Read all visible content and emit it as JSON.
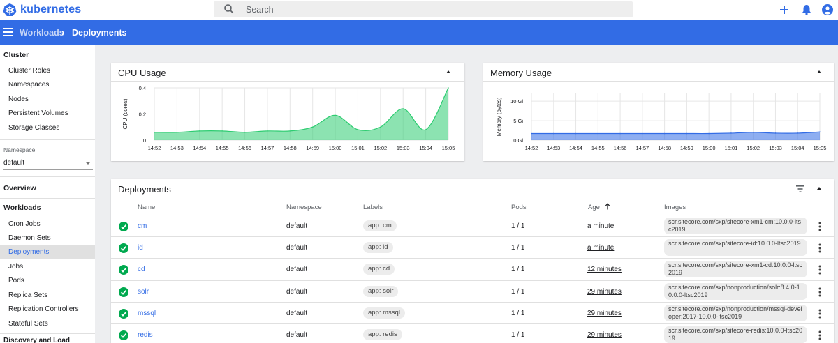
{
  "app": {
    "brand": "kubernetes"
  },
  "search": {
    "placeholder": "Search"
  },
  "breadcrumb": {
    "parent": "Workloads",
    "current": "Deployments"
  },
  "sidebar": {
    "cluster_heading": "Cluster",
    "cluster_items": [
      "Cluster Roles",
      "Namespaces",
      "Nodes",
      "Persistent Volumes",
      "Storage Classes"
    ],
    "namespace_label": "Namespace",
    "namespace_value": "default",
    "overview": "Overview",
    "workloads_heading": "Workloads",
    "workload_items": [
      "Cron Jobs",
      "Daemon Sets",
      "Deployments",
      "Jobs",
      "Pods",
      "Replica Sets",
      "Replication Controllers",
      "Stateful Sets"
    ],
    "active_item": "Deployments",
    "discovery_heading": "Discovery and Load Balancing"
  },
  "cpu": {
    "title": "CPU Usage",
    "chart_data": {
      "type": "area",
      "ylabel": "CPU (cores)",
      "x": [
        "14:52",
        "14:53",
        "14:54",
        "14:55",
        "14:56",
        "14:57",
        "14:58",
        "14:59",
        "15:00",
        "15:01",
        "15:02",
        "15:03",
        "15:04",
        "15:05"
      ],
      "yticks": [
        "0",
        "0.2",
        "0.4"
      ],
      "ylim": [
        0,
        0.4
      ],
      "values": [
        0.06,
        0.06,
        0.07,
        0.07,
        0.06,
        0.07,
        0.07,
        0.1,
        0.19,
        0.08,
        0.1,
        0.24,
        0.08,
        0.4
      ],
      "color": "#2ecc71"
    }
  },
  "memory": {
    "title": "Memory Usage",
    "chart_data": {
      "type": "area",
      "ylabel": "Memory (bytes)",
      "x": [
        "14:52",
        "14:53",
        "14:54",
        "14:55",
        "14:56",
        "14:57",
        "14:58",
        "14:59",
        "15:00",
        "15:01",
        "15:02",
        "15:03",
        "15:04",
        "15:05"
      ],
      "yticks": [
        "0 Gi",
        "5 Gi",
        "10 Gi"
      ],
      "ylim": [
        0,
        12
      ],
      "values": [
        1.7,
        1.7,
        1.7,
        1.7,
        1.7,
        1.7,
        1.7,
        1.7,
        1.7,
        1.8,
        2.0,
        1.8,
        1.8,
        2.1
      ],
      "color": "#326ce5"
    }
  },
  "deployments": {
    "title": "Deployments",
    "columns": {
      "name": "Name",
      "namespace": "Namespace",
      "labels": "Labels",
      "pods": "Pods",
      "age": "Age",
      "images": "Images"
    },
    "rows": [
      {
        "name": "cm",
        "namespace": "default",
        "label": "app: cm",
        "pods": "1 / 1",
        "age": "a minute",
        "image": "scr.sitecore.com/sxp/sitecore-xm1-cm:10.0.0-ltsc2019"
      },
      {
        "name": "id",
        "namespace": "default",
        "label": "app: id",
        "pods": "1 / 1",
        "age": "a minute",
        "image": "scr.sitecore.com/sxp/sitecore-id:10.0.0-ltsc2019"
      },
      {
        "name": "cd",
        "namespace": "default",
        "label": "app: cd",
        "pods": "1 / 1",
        "age": "12 minutes",
        "image": "scr.sitecore.com/sxp/sitecore-xm1-cd:10.0.0-ltsc2019"
      },
      {
        "name": "solr",
        "namespace": "default",
        "label": "app: solr",
        "pods": "1 / 1",
        "age": "29 minutes",
        "image": "scr.sitecore.com/sxp/nonproduction/solr:8.4.0-10.0.0-ltsc2019"
      },
      {
        "name": "mssql",
        "namespace": "default",
        "label": "app: mssql",
        "pods": "1 / 1",
        "age": "29 minutes",
        "image": "scr.sitecore.com/sxp/nonproduction/mssql-developer:2017-10.0.0-ltsc2019"
      },
      {
        "name": "redis",
        "namespace": "default",
        "label": "app: redis",
        "pods": "1 / 1",
        "age": "29 minutes",
        "image": "scr.sitecore.com/sxp/sitecore-redis:10.0.0-ltsc2019"
      }
    ]
  },
  "colors": {
    "accent": "#326ce5",
    "success": "#00a94f",
    "cpu": "#2ecc71",
    "memory": "#326ce5"
  }
}
